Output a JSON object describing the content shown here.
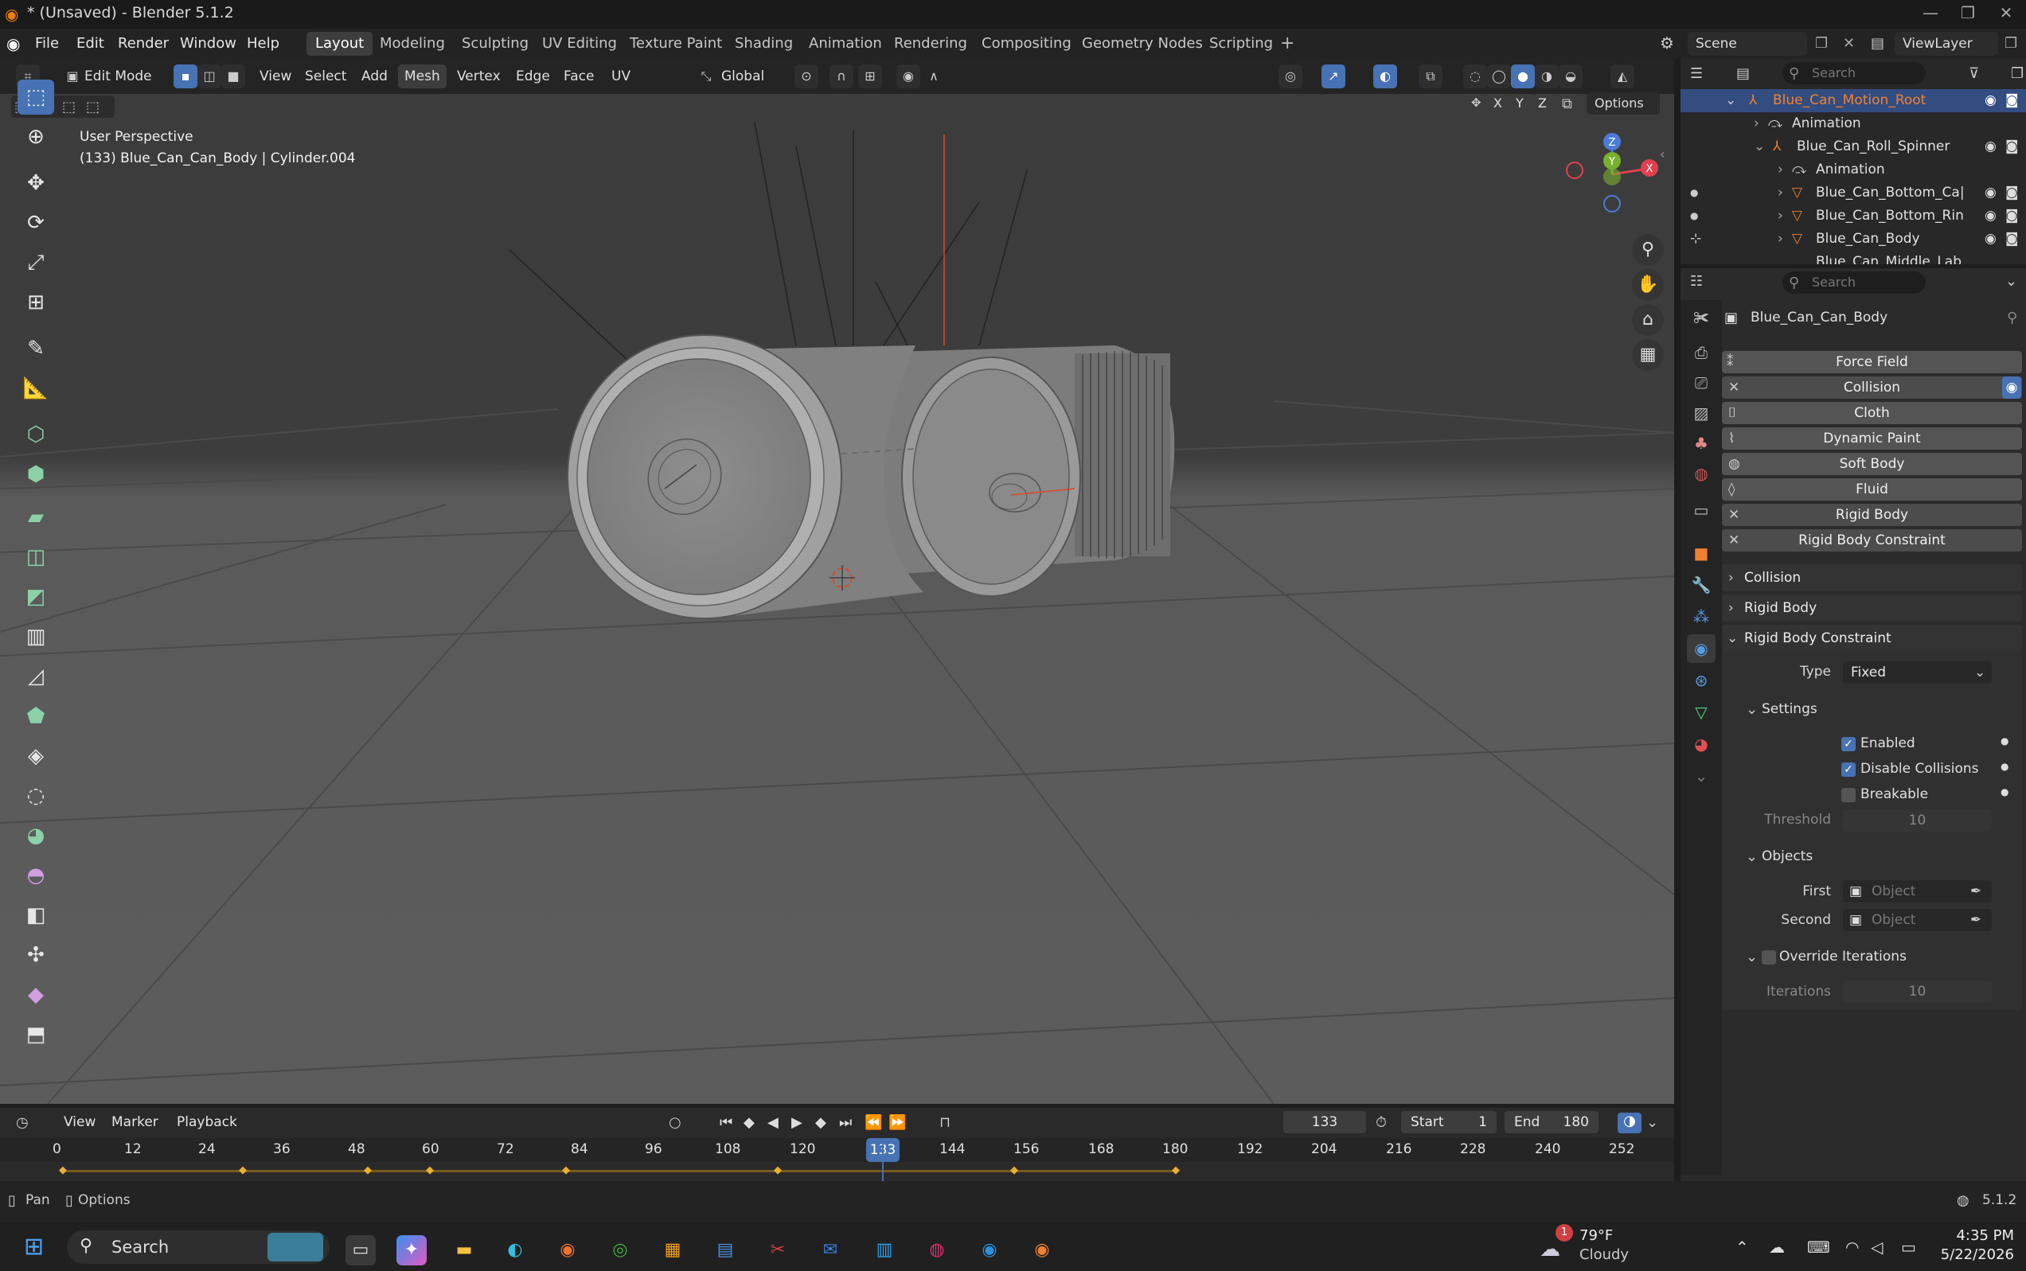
{
  "window": {
    "title": "* (Unsaved) - Blender 5.1.2"
  },
  "menu": {
    "file": "File",
    "edit": "Edit",
    "render": "Render",
    "window": "Window",
    "help": "Help"
  },
  "workspaces": [
    "Layout",
    "Modeling",
    "Sculpting",
    "UV Editing",
    "Texture Paint",
    "Shading",
    "Animation",
    "Rendering",
    "Compositing",
    "Geometry Nodes",
    "Scripting"
  ],
  "scene": {
    "name": "Scene",
    "view_layer": "ViewLayer"
  },
  "viewport_header": {
    "mode": "Edit Mode",
    "menus": [
      "View",
      "Select",
      "Add",
      "Mesh",
      "Vertex",
      "Edge",
      "Face",
      "UV"
    ],
    "orientation": "Global",
    "options": "Options",
    "axes": [
      "X",
      "Y",
      "Z"
    ]
  },
  "viewport": {
    "perspective": "User Perspective",
    "object_info": "(133) Blue_Can_Can_Body | Cylinder.004"
  },
  "gizmo": {
    "z": "Z",
    "y": "Y",
    "x": "X"
  },
  "outliner": {
    "search_placeholder": "Search",
    "rows": [
      "Blue_Can_Motion_Root",
      "Animation",
      "Blue_Can_Roll_Spinner",
      "Animation",
      "Blue_Can_Bottom_Ca|",
      "Blue_Can_Bottom_Rin",
      "Blue_Can_Body",
      "Blue_Can_Middle_Lab"
    ]
  },
  "properties": {
    "search_placeholder": "Search",
    "object_name": "Blue_Can_Can_Body",
    "physics_buttons": [
      "Force Field",
      "Collision",
      "Cloth",
      "Dynamic Paint",
      "Soft Body",
      "Fluid",
      "Rigid Body",
      "Rigid Body Constraint"
    ],
    "panels": {
      "collision": "Collision",
      "rigid_body": "Rigid Body",
      "rigid_body_constraint": "Rigid Body Constraint"
    },
    "type_label": "Type",
    "type_value": "Fixed",
    "settings": "Settings",
    "enabled": "Enabled",
    "disable_collisions": "Disable Collisions",
    "breakable": "Breakable",
    "threshold_label": "Threshold",
    "threshold_value": "10",
    "objects": "Objects",
    "first_label": "First",
    "second_label": "Second",
    "object_placeholder": "Object",
    "override_iterations": "Override Iterations",
    "iterations_label": "Iterations",
    "iterations_value": "10"
  },
  "timeline": {
    "menus": [
      "View",
      "Marker",
      "Playback"
    ],
    "current_frame": "133",
    "start_label": "Start",
    "start_value": "1",
    "end_label": "End",
    "end_value": "180",
    "ruler": [
      "0",
      "12",
      "24",
      "36",
      "48",
      "60",
      "72",
      "84",
      "96",
      "108",
      "120",
      "133",
      "144",
      "156",
      "168",
      "180",
      "192",
      "204",
      "216",
      "228",
      "240",
      "252"
    ]
  },
  "statusbar": {
    "pan": "Pan",
    "options": "Options",
    "version": "5.1.2"
  },
  "taskbar": {
    "search": "Search",
    "weather_temp": "79°F",
    "weather_desc": "Cloudy",
    "weather_badge": "1",
    "time": "4:35 PM",
    "date": "5/22/2026"
  },
  "colors": {
    "accent": "#4772b3",
    "selected_orange": "#f08030",
    "keyframe": "#e8b030"
  }
}
